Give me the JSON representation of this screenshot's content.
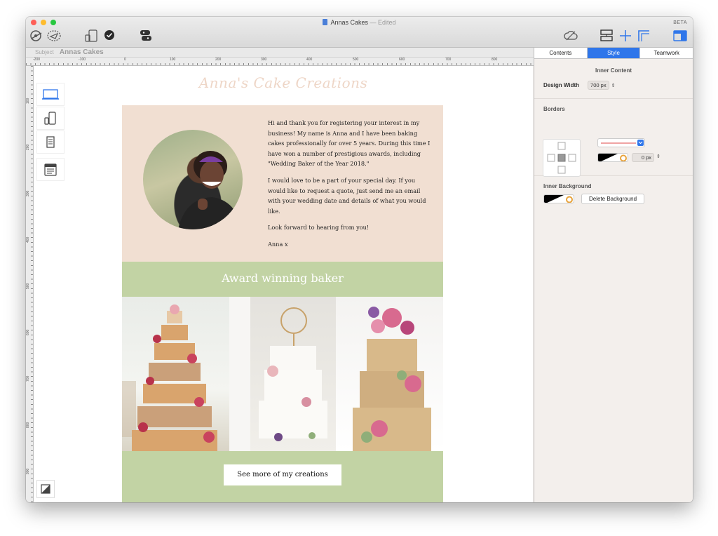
{
  "window": {
    "title": "Annas Cakes",
    "title_status": "— Edited",
    "beta_label": "BETA"
  },
  "subject": {
    "label": "Subject",
    "value": "Annas Cakes"
  },
  "ruler": {
    "h_ticks": [
      "-200",
      "-100",
      "0",
      "100",
      "200",
      "300",
      "400",
      "500",
      "600",
      "700",
      "800"
    ],
    "v_ticks": [
      "100",
      "200",
      "300",
      "400",
      "500",
      "600",
      "700",
      "800",
      "900"
    ]
  },
  "email": {
    "script_title": "Anna's Cake Creations",
    "intro_paragraphs": [
      "Hi and thank you for registering your interest in my business! My name is Anna and I have been baking cakes professionally for over 5 years. During this time I have won a number of prestigious awards, including \"Wedding Baker of the Year 2018.\"",
      "I would love to be a part of your special day. If you would like to request a quote, just send me an  email with your wedding date and details of what you would like.",
      "Look forward to hearing from you!",
      "Anna x"
    ],
    "award_heading": "Award winning baker",
    "cta_label": "See more of my creations"
  },
  "panel": {
    "tabs": [
      "Contents",
      "Style",
      "Teamwork"
    ],
    "active_tab": "Style",
    "inner_content_title": "Inner Content",
    "design_width_label": "Design Width",
    "design_width_value": "700 px",
    "borders_title": "Borders",
    "border_width_value": "0 px",
    "inner_background_title": "Inner Background",
    "delete_background_label": "Delete Background"
  },
  "colors": {
    "accent": "#2f76ea",
    "intro_bg": "#f1dfd2",
    "green_bg": "#c2d3a4",
    "script_title": "#eed6c7"
  }
}
